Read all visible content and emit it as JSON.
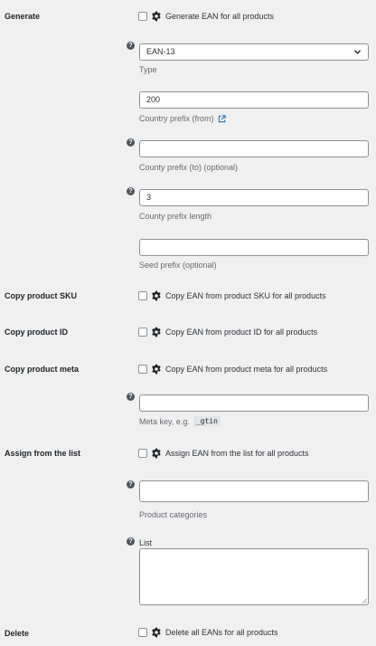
{
  "generate": {
    "label": "Generate",
    "checkbox_label": "Generate EAN for all products",
    "help": "?",
    "type": {
      "value": "EAN-13",
      "description": "Type"
    },
    "country_prefix_from": {
      "value": "200",
      "description": "Country prefix (from)"
    },
    "country_prefix_to": {
      "value": "",
      "description": "County prefix (to) (optional)"
    },
    "country_prefix_length": {
      "value": "3",
      "description": "County prefix length"
    },
    "seed_prefix": {
      "value": "",
      "description": "Seed prefix (optional)"
    }
  },
  "copy_sku": {
    "label": "Copy product SKU",
    "checkbox_label": "Copy EAN from product SKU for all products"
  },
  "copy_id": {
    "label": "Copy product ID",
    "checkbox_label": "Copy EAN from product ID for all products"
  },
  "copy_meta": {
    "label": "Copy product meta",
    "checkbox_label": "Copy EAN from product meta for all products",
    "meta_key": {
      "value": "",
      "description": "Meta key, e.g.",
      "example": "_gtin"
    }
  },
  "assign_list": {
    "label": "Assign from the list",
    "checkbox_label": "Assign EAN from the list for all products",
    "categories": {
      "value": "",
      "description": "Product categories"
    },
    "list": {
      "label": "List",
      "value": ""
    }
  },
  "delete": {
    "label": "Delete",
    "checkbox_label": "Delete all EANs for all products"
  },
  "icons": {
    "gear": "gear-icon",
    "help": "question-mark-icon",
    "external_link": "external-link-icon",
    "chevron": "chevron-down-icon"
  },
  "colors": {
    "background": "#f0f0f1",
    "link": "#2271b1",
    "border": "#8c8f94",
    "help_icon": "#50575e"
  }
}
